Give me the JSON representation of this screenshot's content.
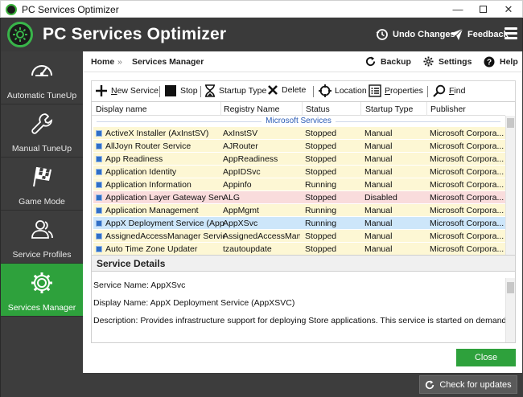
{
  "window": {
    "title": "PC Services Optimizer",
    "minimize_glyph": "—",
    "close_glyph": "✕"
  },
  "header": {
    "app_title": "PC Services Optimizer",
    "undo_label": "Undo Changes",
    "feedback_label": "Feedback"
  },
  "sidebar": {
    "items": [
      {
        "label": "Automatic TuneUp",
        "icon": "speedometer-icon",
        "active": false
      },
      {
        "label": "Manual TuneUp",
        "icon": "wrench-icon",
        "active": false
      },
      {
        "label": "Game Mode",
        "icon": "checkered-flag-icon",
        "active": false
      },
      {
        "label": "Service Profiles",
        "icon": "users-icon",
        "active": false
      },
      {
        "label": "Services Manager",
        "icon": "gear-icon",
        "active": true
      }
    ]
  },
  "breadcrumb": {
    "home": "Home",
    "separator": "»",
    "current": "Services Manager"
  },
  "topbar": {
    "backup": "Backup",
    "settings": "Settings",
    "help": "Help"
  },
  "toolbar": {
    "new_service_first": "N",
    "new_service_rest": "ew Service",
    "stop": "Stop",
    "startup_type": "Startup Type",
    "delete": "Delete",
    "location": "Location",
    "properties_first": "P",
    "properties_rest": "roperties",
    "find_first": "F",
    "find_rest": "ind"
  },
  "grid": {
    "columns": [
      "Display name",
      "Registry Name",
      "Status",
      "Startup Type",
      "Publisher"
    ],
    "group_label": "Microsoft Services",
    "rows": [
      {
        "display": "ActiveX Installer (AxInstSV)",
        "registry": "AxInstSV",
        "status": "Stopped",
        "startup": "Manual",
        "publisher": "Microsoft Corpora...",
        "state": "normal"
      },
      {
        "display": "AllJoyn Router Service",
        "registry": "AJRouter",
        "status": "Stopped",
        "startup": "Manual",
        "publisher": "Microsoft Corpora...",
        "state": "normal"
      },
      {
        "display": "App Readiness",
        "registry": "AppReadiness",
        "status": "Stopped",
        "startup": "Manual",
        "publisher": "Microsoft Corpora...",
        "state": "normal"
      },
      {
        "display": "Application Identity",
        "registry": "AppIDSvc",
        "status": "Stopped",
        "startup": "Manual",
        "publisher": "Microsoft Corpora...",
        "state": "normal"
      },
      {
        "display": "Application Information",
        "registry": "Appinfo",
        "status": "Running",
        "startup": "Manual",
        "publisher": "Microsoft Corpora...",
        "state": "normal"
      },
      {
        "display": "Application Layer Gateway Service",
        "registry": "ALG",
        "status": "Stopped",
        "startup": "Disabled",
        "publisher": "Microsoft Corpora...",
        "state": "disabled"
      },
      {
        "display": "Application Management",
        "registry": "AppMgmt",
        "status": "Running",
        "startup": "Manual",
        "publisher": "Microsoft Corpora...",
        "state": "normal"
      },
      {
        "display": "AppX Deployment Service (AppXS",
        "registry": "AppXSvc",
        "status": "Running",
        "startup": "Manual",
        "publisher": "Microsoft Corpora...",
        "state": "selected"
      },
      {
        "display": "AssignedAccessManager Service",
        "registry": "AssignedAccessMana...",
        "status": "Stopped",
        "startup": "Manual",
        "publisher": "Microsoft Corpora...",
        "state": "normal"
      },
      {
        "display": "Auto Time Zone Updater",
        "registry": "tzautoupdate",
        "status": "Stopped",
        "startup": "Manual",
        "publisher": "Microsoft Corpora...",
        "state": "normal"
      }
    ]
  },
  "details": {
    "heading": "Service Details",
    "service_name": "Service Name: AppXSvc",
    "display_name": "Display Name: AppX Deployment Service (AppXSVC)",
    "description": "Description: Provides infrastructure support for deploying Store applications. This service is started on demand and if disabled Store"
  },
  "buttons": {
    "close": "Close",
    "check_updates": "Check for updates"
  },
  "colors": {
    "accent_green": "#2ea13c",
    "row_normal": "#fdf7d4",
    "row_disabled": "#f9dcdc",
    "row_selected": "#cde6fa"
  }
}
